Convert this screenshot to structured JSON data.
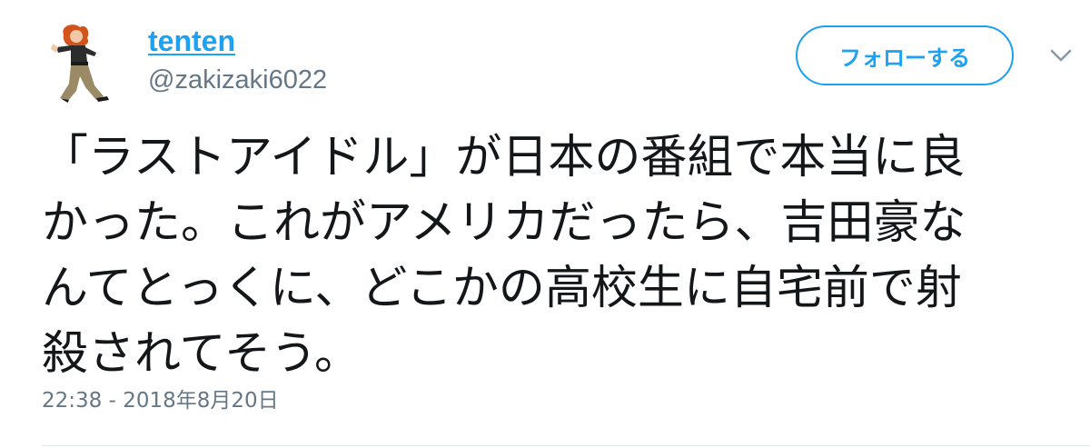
{
  "user": {
    "display_name": "tenten",
    "handle": "@zakizaki6022",
    "avatar_icon": "cartoon-character-avatar"
  },
  "follow_button": {
    "label": "フォローする"
  },
  "menu": {
    "icon": "chevron-down-icon"
  },
  "tweet": {
    "text_lines": [
      "「ラストアイドル」が日本の番組で本当に良",
      "かった。これがアメリカだったら、吉田豪な",
      "んてとっくに、どこかの高校生に自宅前で射",
      "殺されてそう。"
    ],
    "timestamp": "22:38 - 2018年8月20日"
  },
  "colors": {
    "accent": "#1da1f2",
    "secondary_text": "#657786",
    "primary_text": "#14171a",
    "divider": "#e1e8ed"
  }
}
